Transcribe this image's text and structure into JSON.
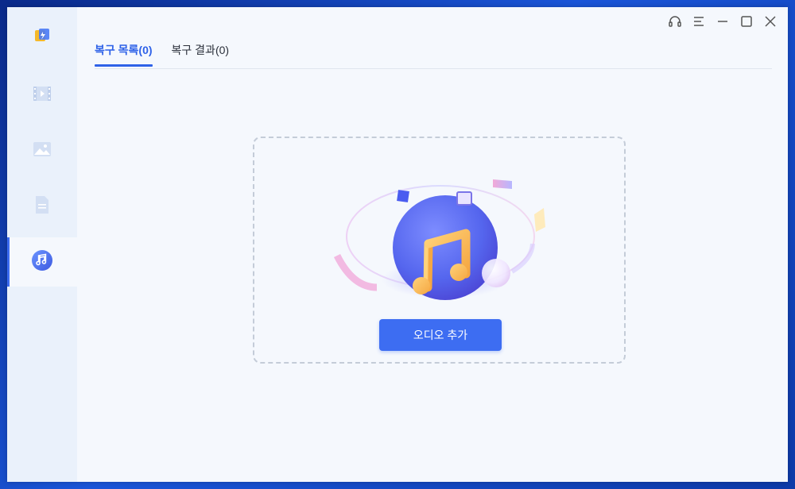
{
  "window": {
    "controls": {
      "support_icon": "headset-icon",
      "menu_icon": "menu-icon",
      "minimize_icon": "minimize-icon",
      "maximize_icon": "maximize-icon",
      "close_icon": "close-icon"
    }
  },
  "sidebar": {
    "logo_icon": "app-logo-icon",
    "items": [
      {
        "icon": "video-icon",
        "active": false
      },
      {
        "icon": "photo-icon",
        "active": false
      },
      {
        "icon": "document-icon",
        "active": false
      },
      {
        "icon": "music-note-icon",
        "active": true
      }
    ]
  },
  "tabs": [
    {
      "label": "복구 목록(0)",
      "active": true
    },
    {
      "label": "복구 결과(0)",
      "active": false
    }
  ],
  "main": {
    "illustration_icon": "music-disc-icon",
    "add_button_label": "오디오 추가"
  },
  "colors": {
    "accent": "#3d6df2",
    "sidebar_bg": "#eaf1fb",
    "content_bg": "#f5f8fd"
  }
}
